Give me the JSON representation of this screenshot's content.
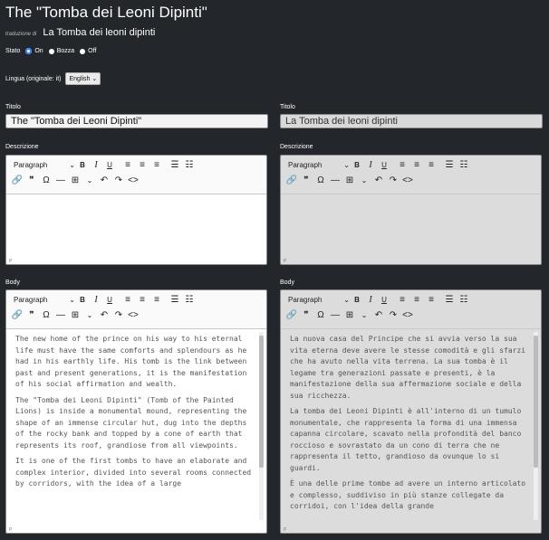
{
  "page": {
    "title": "The \"Tomba dei Leoni Dipinti\"",
    "translation_prefix": "traduzione di",
    "translation_title": "La Tomba dei leoni dipinti"
  },
  "status": {
    "label": "Stato",
    "options": [
      "On",
      "Bozza",
      "Off"
    ],
    "selected": "On"
  },
  "language": {
    "label": "Lingua (originale: it)",
    "selected": "English"
  },
  "left": {
    "title_label": "Titolo",
    "title_value": "The \"Tomba dei Leoni Dipinti\"",
    "description_label": "Descrizione",
    "body_label": "Body",
    "body_paragraphs": [
      "The new home of the prince on his way to his eternal life must have the same comforts and splendours as he had in his earthly life. His tomb is the link between past and present generations, it is the manifestation of his social affirmation and wealth.",
      "The \"Tomba dei Leoni Dipinti\" (Tomb of the Painted Lions) is inside a monumental mound, representing the shape of an immense circular hut, dug into the depths of the rocky bank and topped by a cone of earth that represents its roof, grandiose from all viewpoints.",
      "It is one of the first tombs to have an elaborate and complex interior, divided into several rooms connected by corridors, with the idea of a large"
    ]
  },
  "right": {
    "title_label": "Titolo",
    "title_value": "La Tomba dei leoni dipinti",
    "description_label": "Descrizione",
    "body_label": "Body",
    "body_paragraphs": [
      "La nuova casa del Principe che si avvia verso la sua vita eterna deve avere le stesse comodità e gli sfarzi che ha avuto nella vita terrena. La sua tomba è il legame tra generazioni passate e presenti, è la manifestazione della sua affermazione sociale e della sua ricchezza.",
      "La tomba dei Leoni Dipinti è all'interno di un tumulo monumentale, che rappresenta la forma di una immensa capanna circolare, scavato nella profondità del banco roccioso e sovrastato da un cono di terra che ne rappresenta il tetto, grandioso da ovunque lo si guardi.",
      "È una delle prime tombe ad avere un interno articolato e complesso, suddiviso in più stanze collegate da corridoi, con l'idea della grande"
    ]
  },
  "toolbar": {
    "paragraph": "Paragraph",
    "chevron": "⌄",
    "bold": "B",
    "italic": "I",
    "underline": "U",
    "align_left": "≡",
    "align_center": "≡",
    "align_right": "≡",
    "bullet_list": "☰",
    "numbered_list": "☷",
    "link": "🔗",
    "quote": "❞",
    "omega": "Ω",
    "hr": "—",
    "table": "⊞",
    "undo": "↶",
    "redo": "↷",
    "source": "<>"
  },
  "editor_path": "P"
}
